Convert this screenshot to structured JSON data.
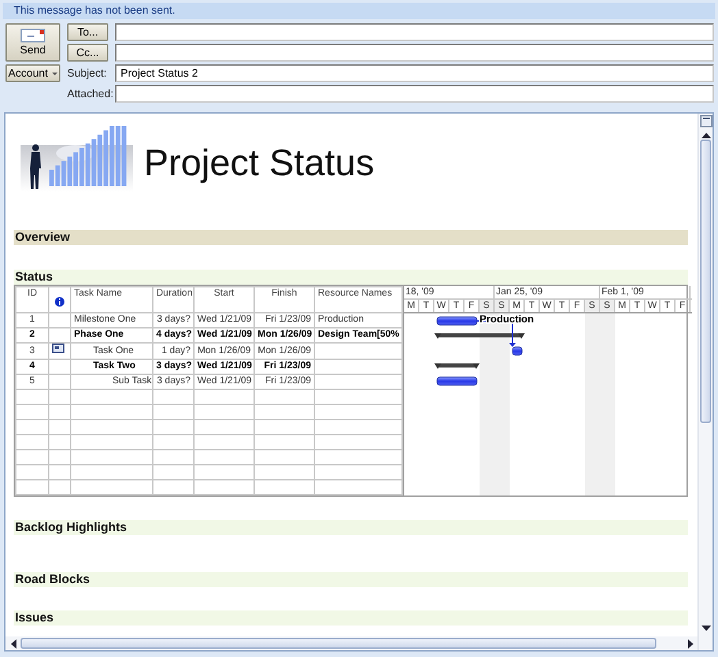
{
  "info_bar": {
    "text": "This message has not been sent."
  },
  "header": {
    "send_button": "Send",
    "account_button": "Account",
    "to_button": "To...",
    "cc_button": "Cc...",
    "subject": {
      "label": "Subject:",
      "value": "Project Status 2"
    },
    "attached": {
      "label": "Attached:"
    }
  },
  "document": {
    "title": "Project Status",
    "sections": [
      {
        "title": "Overview",
        "color": "#e4dfc8"
      },
      {
        "title": "Status",
        "color": "#f1f8e6",
        "kind": "gantt"
      },
      {
        "title": "Backlog Highlights",
        "color": "#f1f8e6"
      },
      {
        "title": "Road Blocks",
        "color": "#f1f8e6"
      },
      {
        "title": "Issues",
        "color": "#f1f8e6"
      }
    ],
    "table": {
      "columns": [
        "ID",
        "Task Name",
        "Duration",
        "Start",
        "Finish",
        "Resource Names"
      ],
      "tasks": [
        {
          "id": "1",
          "name": "Milestone One",
          "duration": "3 days?",
          "start": "Wed 1/21/09",
          "finish": "Fri 1/23/09",
          "resource": "Production",
          "bar_label": "Production",
          "summary": false,
          "indicator": false
        },
        {
          "id": "2",
          "name": "Phase One",
          "duration": "4 days?",
          "start": "Wed 1/21/09",
          "finish": "Mon 1/26/09",
          "resource": "Design Team[50%",
          "summary": true,
          "indicator": false,
          "children": [
            {
              "id": "3",
              "name": "Task One",
              "duration": "1 day?",
              "start": "Mon 1/26/09",
              "finish": "Mon 1/26/09",
              "linked": true,
              "summary": false,
              "indicator": true
            },
            {
              "id": "4",
              "name": "Task Two",
              "duration": "3 days?",
              "start": "Wed 1/21/09",
              "finish": "Fri 1/23/09",
              "summary": true,
              "indicator": false,
              "children": [
                {
                  "id": "5",
                  "name": "Sub Task",
                  "duration": "3 days?",
                  "start": "Wed 1/21/09",
                  "finish": "Fri 1/23/09",
                  "summary": false,
                  "indicator": false
                }
              ]
            }
          ]
        }
      ],
      "weeks": [
        {
          "label": "18, '09",
          "days": [
            {
              "letter": "M",
              "nonworking": false
            },
            {
              "letter": "T",
              "nonworking": false
            },
            {
              "letter": "W",
              "nonworking": false
            },
            {
              "letter": "T",
              "nonworking": false
            },
            {
              "letter": "F",
              "nonworking": false
            },
            {
              "letter": "S",
              "nonworking": true
            }
          ]
        },
        {
          "label": "Jan 25, '09",
          "days": [
            {
              "letter": "S",
              "nonworking": true
            },
            {
              "letter": "M",
              "nonworking": false
            },
            {
              "letter": "T",
              "nonworking": false
            },
            {
              "letter": "W",
              "nonworking": false
            },
            {
              "letter": "T",
              "nonworking": false
            },
            {
              "letter": "F",
              "nonworking": false
            },
            {
              "letter": "S",
              "nonworking": true
            }
          ]
        },
        {
          "label": "Feb 1, '09",
          "days": [
            {
              "letter": "S",
              "nonworking": true
            },
            {
              "letter": "M",
              "nonworking": false
            },
            {
              "letter": "T",
              "nonworking": false
            },
            {
              "letter": "W",
              "nonworking": false
            },
            {
              "letter": "T",
              "nonworking": false
            },
            {
              "letter": "F",
              "nonworking": false
            }
          ]
        }
      ]
    }
  }
}
